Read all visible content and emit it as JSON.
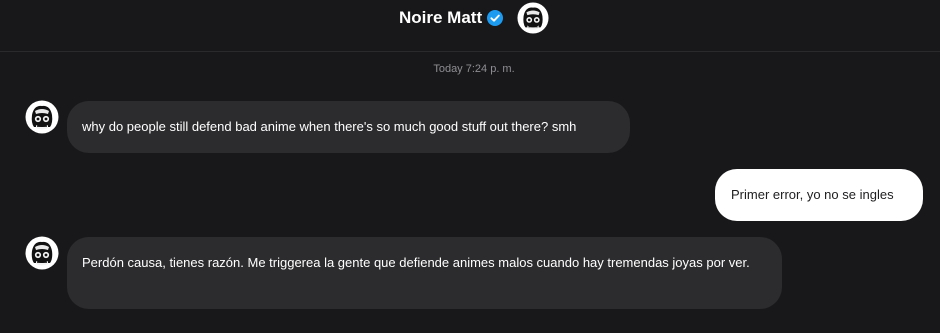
{
  "header": {
    "title": "Noire Matt",
    "verified_icon": "verified-badge-icon",
    "avatar_icon": "profile-avatar"
  },
  "timestamp": "Today 7:24 p. m.",
  "colors": {
    "background": "#18181a",
    "incoming_bubble": "#2c2c2f",
    "outgoing_bubble": "#ffffff",
    "verified": "#1d9bf0"
  },
  "messages": [
    {
      "sender": "Noire Matt",
      "direction": "incoming",
      "text": "why do people still defend bad anime when there's so much good stuff out there? smh"
    },
    {
      "sender": "me",
      "direction": "outgoing",
      "text": "Primer error, yo no se ingles"
    },
    {
      "sender": "Noire Matt",
      "direction": "incoming",
      "text": "Perdón causa, tienes razón. Me triggerea la gente que defiende animes malos cuando hay tremendas joyas por ver."
    }
  ]
}
